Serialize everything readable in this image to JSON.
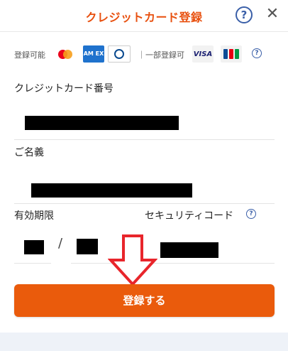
{
  "header": {
    "title": "クレジットカード登録",
    "help_glyph": "?",
    "close_glyph": "✕"
  },
  "brands": {
    "available_label": "登録可能",
    "partial_label": "一部登録可",
    "amex_text": "AM EX",
    "visa_text": "VISA",
    "help_glyph": "?",
    "colors": {
      "mastercard_red": "#eb001b",
      "mastercard_orange": "#f79e1b",
      "amex_blue": "#1f72cd",
      "visa_navy": "#1a1f71"
    }
  },
  "form": {
    "card_number_label": "クレジットカード番号",
    "card_name_label": "ご名義",
    "expiry_label": "有効期限",
    "security_code_label": "セキュリティコード",
    "expiry_separator": "/",
    "security_help_glyph": "?"
  },
  "submit": {
    "label": "登録する"
  },
  "theme": {
    "accent": "#ea5b0c",
    "title_color": "#e8500f",
    "help_blue": "#3a5fa8"
  }
}
